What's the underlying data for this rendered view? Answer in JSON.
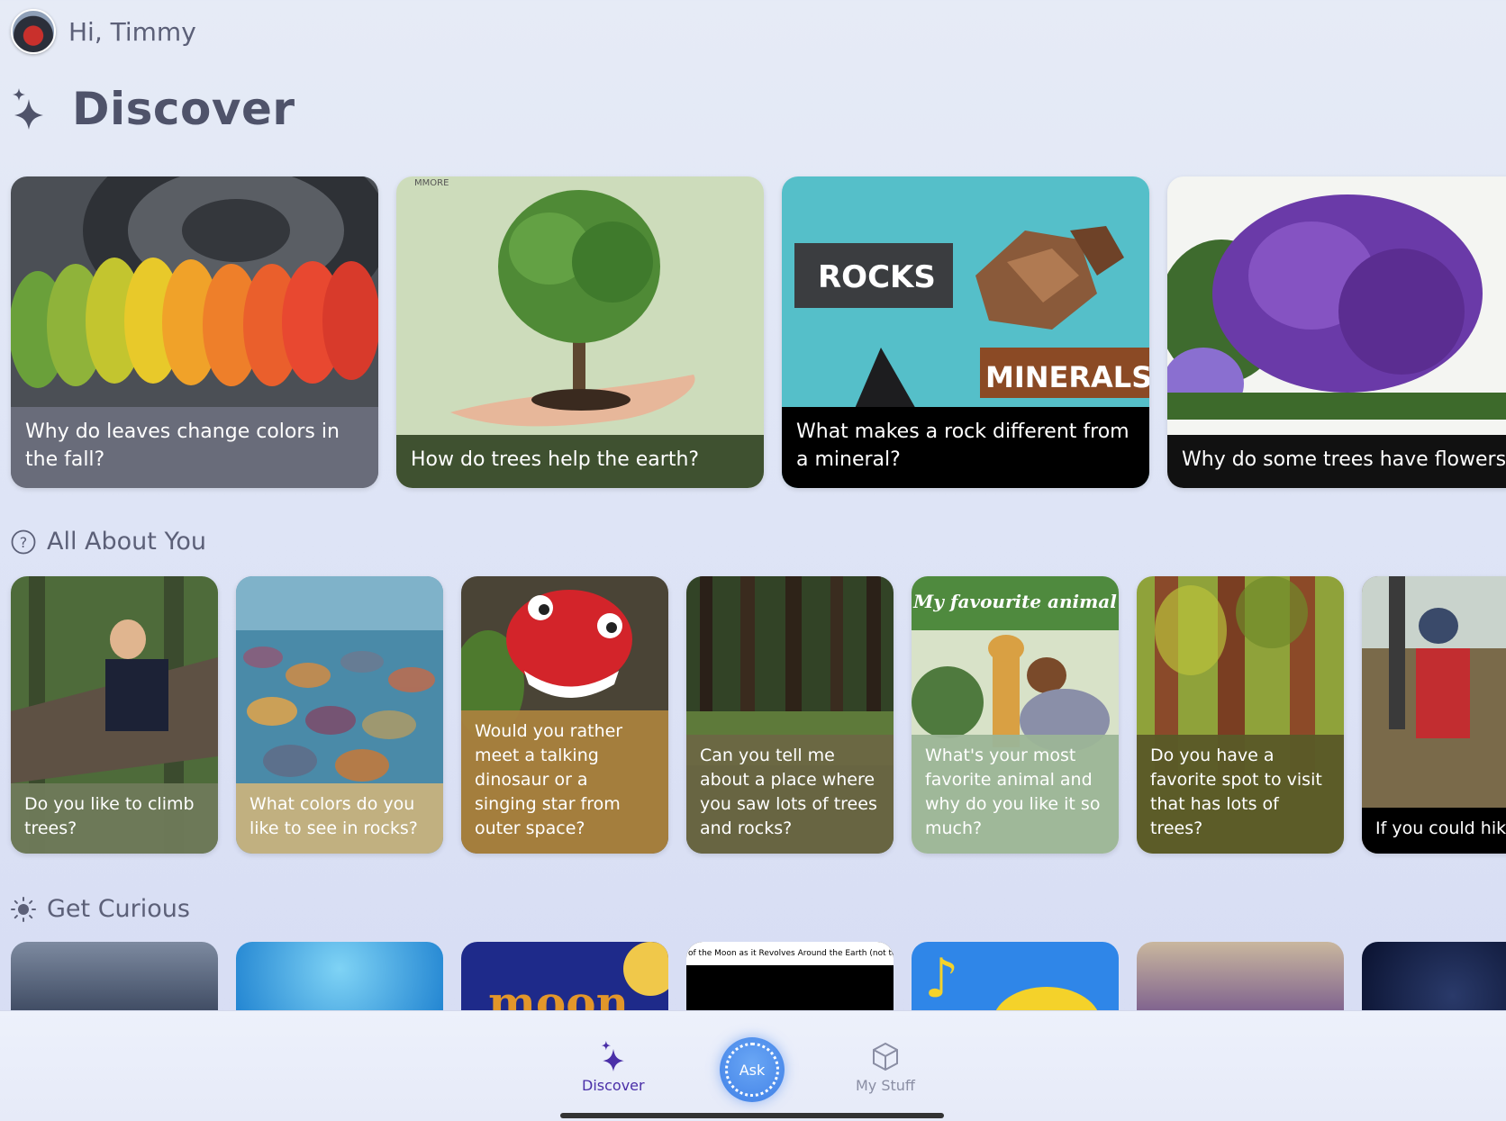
{
  "header": {
    "greeting": "Hi, Timmy"
  },
  "page": {
    "title": "Discover"
  },
  "featured": [
    {
      "question": "Why do leaves change colors in the fall?",
      "caption_color": "#6b6f7e"
    },
    {
      "question": "How do trees help the earth?",
      "caption_color": "#3f5130",
      "watermark": "MMORE"
    },
    {
      "question": "What makes a rock different from a mineral?",
      "caption_color": "#000000",
      "art_text_1": "ROCKS",
      "art_text_2": "MINERALS"
    },
    {
      "question": "Why do some trees have flowers?",
      "caption_color": "#111111"
    }
  ],
  "sections": {
    "about_you": "All About You",
    "get_curious": "Get Curious"
  },
  "about_you_cards": [
    {
      "question": "Do you like to climb trees?",
      "caption_color": "#6f7a5a"
    },
    {
      "question": "What colors do you like to see in rocks?",
      "caption_color": "#c7b27d"
    },
    {
      "question": "Would you rather meet a talking dinosaur or a singing star from outer space?",
      "caption_color": "#a9823e"
    },
    {
      "question": "Can you tell me about a place where you saw lots of trees and rocks?",
      "caption_color": "#6b6743"
    },
    {
      "question": "What's your most favorite animal and why do you like it so much?",
      "caption_color": "#9cb597",
      "art_text": "My favourite animal"
    },
    {
      "question": "Do you have a favorite spot to visit that has lots of trees?",
      "caption_color": "#5a5a28"
    },
    {
      "question": "If you could hike anywhere in the world, where would you want to explore?",
      "caption_color": "#000000"
    }
  ],
  "curious_cards": [
    {
      "art_text": ""
    },
    {
      "art_text": ""
    },
    {
      "art_text": "moon"
    },
    {
      "art_text": "of the Moon as it Revolves Around the Earth (not to"
    },
    {
      "art_text": ""
    },
    {
      "art_text": ""
    },
    {
      "art_text": ""
    }
  ],
  "nav": {
    "discover": "Discover",
    "ask": "Ask",
    "my_stuff": "My Stuff"
  },
  "colors": {
    "accent": "#4a2fa8",
    "ask": "#3f7fe6"
  }
}
